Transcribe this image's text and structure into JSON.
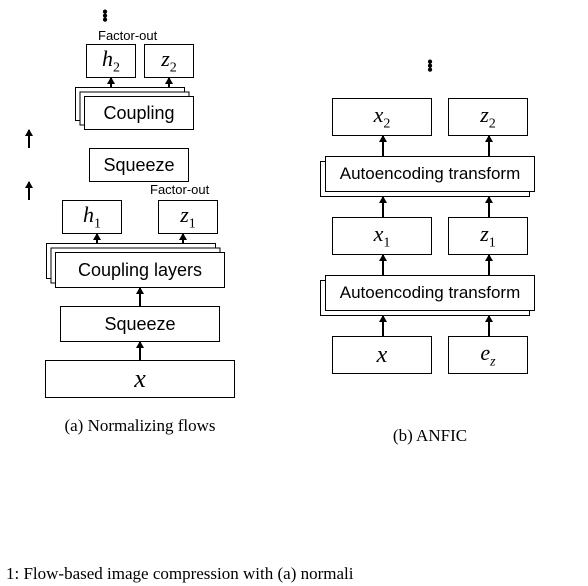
{
  "dots": "⋮",
  "colA": {
    "caption": "(a) Normalizing flows",
    "top_factor_out": "Factor-out",
    "h2": "h",
    "h2_sub": "2",
    "z2": "z",
    "z2_sub": "2",
    "coupling_top": "Coupling",
    "squeeze_top": "Squeeze",
    "mid_factor_out": "Factor-out",
    "h1": "h",
    "h1_sub": "1",
    "z1": "z",
    "z1_sub": "1",
    "coupling_layers": "Coupling layers",
    "squeeze_bottom": "Squeeze",
    "x": "x"
  },
  "colB": {
    "caption": "(b) ANFIC",
    "x2": "x",
    "x2_sub": "2",
    "z2": "z",
    "z2_sub": "2",
    "autoenc": "Autoencoding transform",
    "x1": "x",
    "x1_sub": "1",
    "z1": "z",
    "z1_sub": "1",
    "x": "x",
    "ez": "e",
    "ez_sub": "z"
  },
  "footer": "1:  Flow-based  image  compression  with  (a)  normali"
}
